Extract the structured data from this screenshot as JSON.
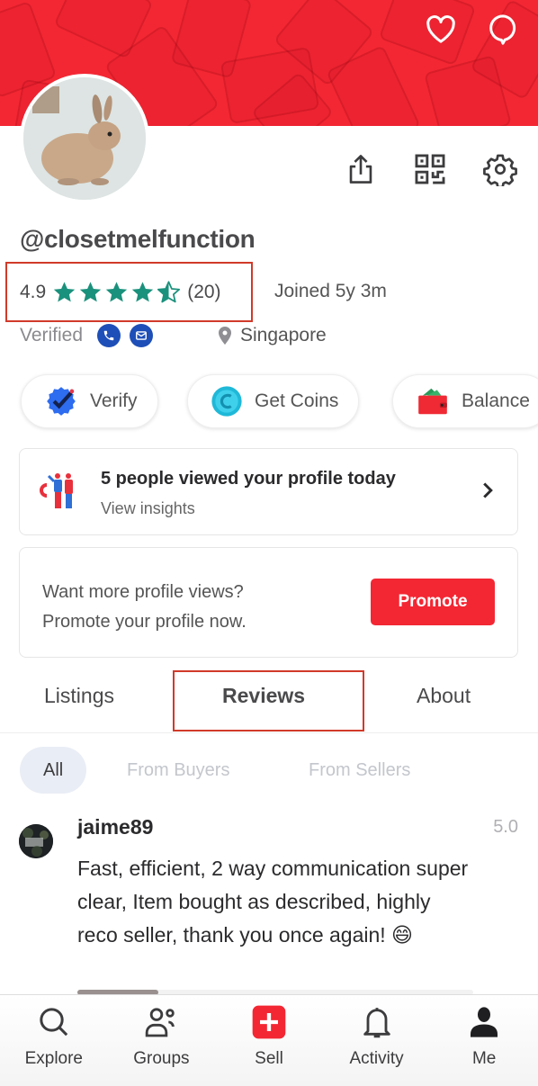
{
  "header": {
    "icons": [
      "heart-icon",
      "chat-icon"
    ],
    "colors": {
      "brand": "#f32733",
      "star": "#1a917c",
      "verified_blue": "#1e4fb8"
    }
  },
  "profile": {
    "username": "@closetmelfunction",
    "rating": "4.9",
    "rating_value": 4.9,
    "review_count": "(20)",
    "joined": "Joined 5y 3m",
    "verified_label": "Verified",
    "location": "Singapore"
  },
  "actions": {
    "share": "share-icon",
    "qr": "qr-code-icon",
    "settings": "gear-icon"
  },
  "pills": [
    {
      "label": "Verify",
      "icon": "verified-badge-icon"
    },
    {
      "label": "Get Coins",
      "icon": "coin-icon"
    },
    {
      "label": "Balance",
      "icon": "wallet-icon"
    }
  ],
  "insights": {
    "title": "5 people viewed your profile today",
    "subtitle": "View insights"
  },
  "promo": {
    "line1": "Want more profile views?",
    "line2": "Promote your profile now.",
    "button": "Promote"
  },
  "tabs": [
    {
      "label": "Listings",
      "active": false
    },
    {
      "label": "Reviews",
      "active": true
    },
    {
      "label": "About",
      "active": false
    }
  ],
  "filters": [
    {
      "label": "All",
      "active": true
    },
    {
      "label": "From Buyers",
      "active": false
    },
    {
      "label": "From Sellers",
      "active": false
    }
  ],
  "reviews": [
    {
      "user": "jaime89",
      "score": "5.0",
      "text": "Fast, efficient, 2 way communication super clear, Item bought as described, highly reco seller, thank you once again! 😄"
    }
  ],
  "nav": [
    {
      "label": "Explore",
      "icon": "search-icon"
    },
    {
      "label": "Groups",
      "icon": "groups-icon"
    },
    {
      "label": "Sell",
      "icon": "plus-icon"
    },
    {
      "label": "Activity",
      "icon": "bell-icon"
    },
    {
      "label": "Me",
      "icon": "person-icon"
    }
  ]
}
